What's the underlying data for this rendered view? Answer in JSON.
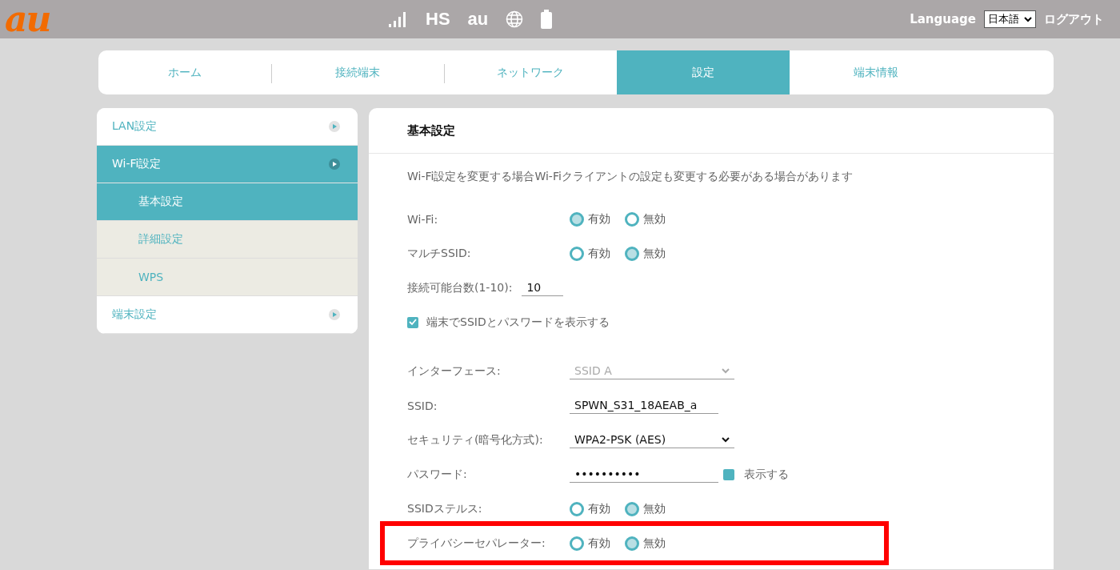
{
  "header": {
    "logo": "au",
    "status": [
      "HS",
      "au"
    ],
    "language_label": "Language",
    "language": "日本語",
    "logout": "ログアウト"
  },
  "tabs": [
    {
      "label": "ホーム",
      "selected": false
    },
    {
      "label": "接続端末",
      "selected": false
    },
    {
      "label": "ネットワーク",
      "selected": false
    },
    {
      "label": "設定",
      "selected": true
    },
    {
      "label": "端末情報",
      "selected": false
    }
  ],
  "sidebar": {
    "items": [
      {
        "label": "LAN設定",
        "selected": false
      },
      {
        "label": "Wi-Fi設定",
        "selected": true,
        "children": [
          {
            "label": "基本設定",
            "selected": true
          },
          {
            "label": "詳細設定",
            "selected": false
          },
          {
            "label": "WPS",
            "selected": false
          }
        ]
      },
      {
        "label": "端末設定",
        "selected": false
      }
    ]
  },
  "panel": {
    "title": "基本設定",
    "notice": "Wi-Fi設定を変更する場合Wi-Fiクライアントの設定も変更する必要がある場合があります",
    "sections": [
      [
        {
          "kind": "radio",
          "label": "Wi-Fi:",
          "highlighted": false,
          "options": [
            {
              "label": "有効",
              "selected": true
            },
            {
              "label": "無効",
              "selected": false
            }
          ]
        },
        {
          "kind": "radio",
          "label": "マルチSSID:",
          "highlighted": false,
          "options": [
            {
              "label": "有効",
              "selected": false
            },
            {
              "label": "無効",
              "selected": true
            }
          ]
        },
        {
          "kind": "text",
          "label": "接続可能台数(1-10):",
          "value": "10",
          "highlighted": false
        },
        {
          "kind": "checkbox",
          "label": "端末でSSIDとパスワードを表示する",
          "checked": true,
          "highlighted": false
        }
      ],
      [
        {
          "kind": "select",
          "label": "インターフェース:",
          "value": "SSID A",
          "disabled": true,
          "highlighted": false
        },
        {
          "kind": "text",
          "label": "SSID:",
          "value": "SPWN_S31_18AEAB_a",
          "highlighted": false
        },
        {
          "kind": "select",
          "label": "セキュリティ(暗号化方式):",
          "value": "WPA2-PSK (AES)",
          "disabled": false,
          "highlighted": false
        },
        {
          "kind": "password",
          "label": "パスワード:",
          "value": "••••••••••",
          "show_label": "表示する",
          "show_checked": false,
          "highlighted": false
        },
        {
          "kind": "radio",
          "label": "SSIDステルス:",
          "highlighted": false,
          "options": [
            {
              "label": "有効",
              "selected": false
            },
            {
              "label": "無効",
              "selected": true
            }
          ]
        },
        {
          "kind": "radio",
          "label": "プライバシーセパレーター:",
          "highlighted": true,
          "options": [
            {
              "label": "有効",
              "selected": false
            },
            {
              "label": "無効",
              "selected": true
            }
          ]
        }
      ]
    ]
  }
}
